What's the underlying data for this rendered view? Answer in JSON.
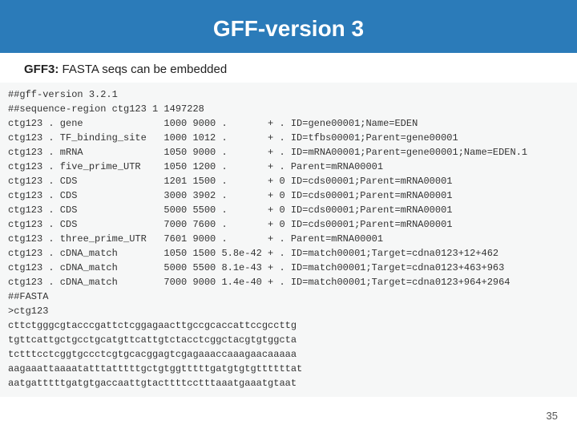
{
  "header": {
    "title": "GFF-version 3"
  },
  "subtitle": {
    "label": "GFF3:",
    "text": " FASTA seqs can be embedded"
  },
  "gff": {
    "pragmas": [
      "##gff-version 3.2.1",
      "##sequence-region ctg123 1 1497228"
    ],
    "rows": [
      {
        "seqid": "ctg123",
        "source": ".",
        "type": "gene",
        "start": "1000",
        "end": "9000",
        "score": ".",
        "strand": "+",
        "phase": ".",
        "attrs": "ID=gene00001;Name=EDEN"
      },
      {
        "seqid": "ctg123",
        "source": ".",
        "type": "TF_binding_site",
        "start": "1000",
        "end": "1012",
        "score": ".",
        "strand": "+",
        "phase": ".",
        "attrs": "ID=tfbs00001;Parent=gene00001"
      },
      {
        "seqid": "ctg123",
        "source": ".",
        "type": "mRNA",
        "start": "1050",
        "end": "9000",
        "score": ".",
        "strand": "+",
        "phase": ".",
        "attrs": "ID=mRNA00001;Parent=gene00001;Name=EDEN.1"
      },
      {
        "seqid": "ctg123",
        "source": ".",
        "type": "five_prime_UTR",
        "start": "1050",
        "end": "1200",
        "score": ".",
        "strand": "+",
        "phase": ".",
        "attrs": "Parent=mRNA00001"
      },
      {
        "seqid": "ctg123",
        "source": ".",
        "type": "CDS",
        "start": "1201",
        "end": "1500",
        "score": ".",
        "strand": "+",
        "phase": "0",
        "attrs": "ID=cds00001;Parent=mRNA00001"
      },
      {
        "seqid": "ctg123",
        "source": ".",
        "type": "CDS",
        "start": "3000",
        "end": "3902",
        "score": ".",
        "strand": "+",
        "phase": "0",
        "attrs": "ID=cds00001;Parent=mRNA00001"
      },
      {
        "seqid": "ctg123",
        "source": ".",
        "type": "CDS",
        "start": "5000",
        "end": "5500",
        "score": ".",
        "strand": "+",
        "phase": "0",
        "attrs": "ID=cds00001;Parent=mRNA00001"
      },
      {
        "seqid": "ctg123",
        "source": ".",
        "type": "CDS",
        "start": "7000",
        "end": "7600",
        "score": ".",
        "strand": "+",
        "phase": "0",
        "attrs": "ID=cds00001;Parent=mRNA00001"
      },
      {
        "seqid": "ctg123",
        "source": ".",
        "type": "three_prime_UTR",
        "start": "7601",
        "end": "9000",
        "score": ".",
        "strand": "+",
        "phase": ".",
        "attrs": "Parent=mRNA00001"
      },
      {
        "seqid": "ctg123",
        "source": ".",
        "type": "cDNA_match",
        "start": "1050",
        "end": "1500",
        "score": "5.8e-42",
        "strand": "+",
        "phase": ".",
        "attrs": "ID=match00001;Target=cdna0123+12+462"
      },
      {
        "seqid": "ctg123",
        "source": ".",
        "type": "cDNA_match",
        "start": "5000",
        "end": "5500",
        "score": "8.1e-43",
        "strand": "+",
        "phase": ".",
        "attrs": "ID=match00001;Target=cdna0123+463+963"
      },
      {
        "seqid": "ctg123",
        "source": ".",
        "type": "cDNA_match",
        "start": "7000",
        "end": "9000",
        "score": "1.4e-40",
        "strand": "+",
        "phase": ".",
        "attrs": "ID=match00001;Target=cdna0123+964+2964"
      }
    ],
    "fasta_header": "##FASTA",
    "fasta_defline": ">ctg123",
    "fasta_seq": [
      "cttctgggcgtacccgattctcggagaacttgccgcaccattccgccttg",
      "tgttcattgctgcctgcatgttcattgtctacctcggctacgtgtggcta",
      "tctttcctcggtgccctcgtgcacggagtcgagaaaccaaagaacaaaaa",
      "aagaaattaaaatatttatttttgctgtggtttttgatgtgtgttttttat",
      "aatgatttttgatgtgaccaattgtacttttcctttaaatgaaatgtaat"
    ]
  },
  "page_number": "35"
}
